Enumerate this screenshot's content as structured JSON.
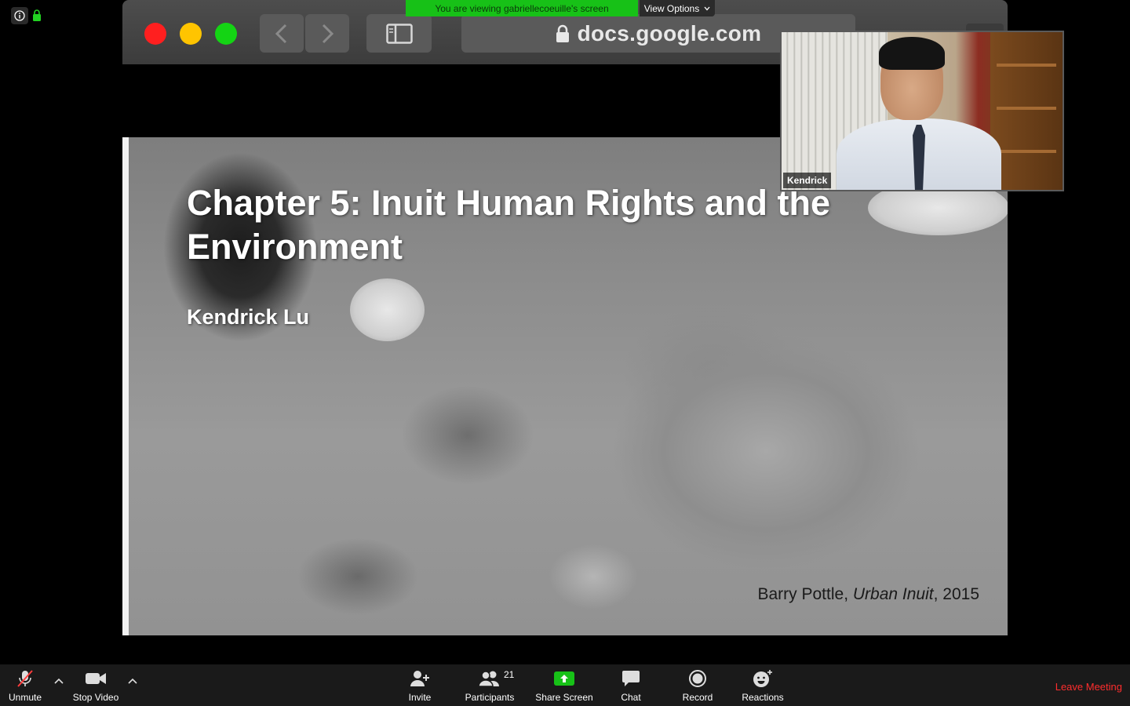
{
  "window": {
    "title": "Zoom Meeting"
  },
  "banner": {
    "text": "You are viewing gabriellecoeuille's screen",
    "view_options": "View Options"
  },
  "browser": {
    "url": "docs.google.com"
  },
  "slide": {
    "title": "Chapter 5: Inuit Human Rights and the Environment",
    "author": "Kendrick Lu",
    "credit_author": "Barry Pottle, ",
    "credit_work": "Urban Inuit",
    "credit_year": ", 2015"
  },
  "video": {
    "participant_name": "Kendrick"
  },
  "toolbar": {
    "unmute": "Unmute",
    "stop_video": "Stop Video",
    "invite": "Invite",
    "participants": "Participants",
    "participant_count": "21",
    "share_screen": "Share Screen",
    "chat": "Chat",
    "record": "Record",
    "reactions": "Reactions",
    "leave": "Leave Meeting"
  },
  "colors": {
    "share_green": "#17c117",
    "leave_red": "#ff2d2d",
    "toolbar_bg": "#1a1a1a"
  },
  "icons": [
    "info-icon",
    "lock-icon",
    "mic-muted-icon",
    "video-camera-icon",
    "invite-icon",
    "participants-icon",
    "share-screen-icon",
    "chat-icon",
    "record-icon",
    "reactions-icon"
  ]
}
